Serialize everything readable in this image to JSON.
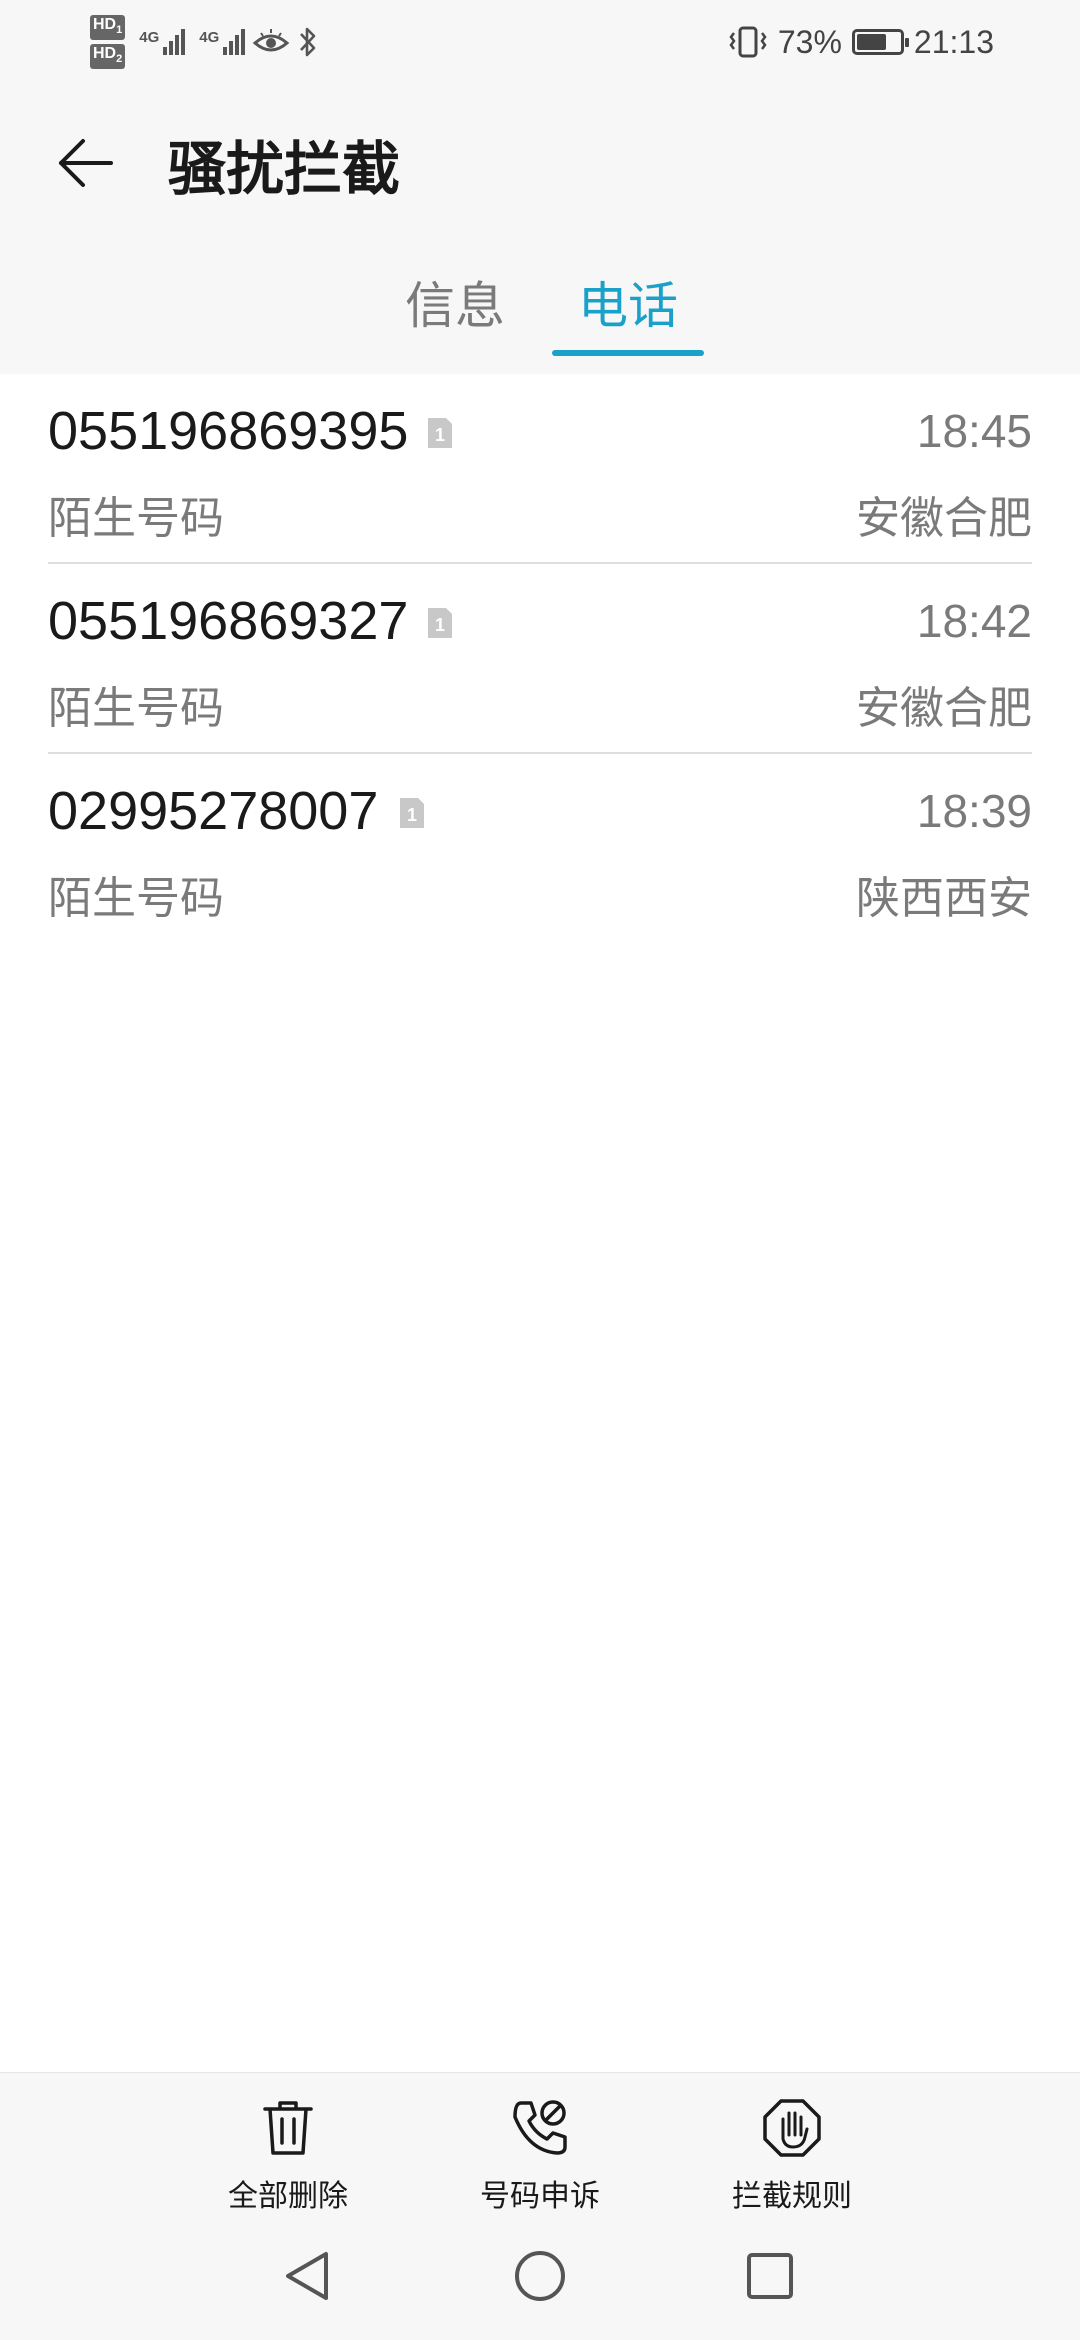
{
  "status_bar": {
    "hd1": "HD",
    "hd1_sim": "1",
    "hd2": "HD",
    "hd2_sim": "2",
    "network1": "4G",
    "network2": "4G",
    "battery_percent": "73%",
    "battery_level": 0.73,
    "time": "21:13",
    "icons": [
      "vibrate-icon",
      "eye-comfort-icon",
      "bluetooth-icon"
    ]
  },
  "header": {
    "title": "骚扰拦截",
    "back_icon": "arrow-left-icon",
    "tabs": [
      {
        "label": "信息",
        "active": false
      },
      {
        "label": "电话",
        "active": true
      }
    ]
  },
  "calls": [
    {
      "number": "055196869395",
      "label": "陌生号码",
      "time": "18:45",
      "location": "安徽合肥",
      "sim": "1"
    },
    {
      "number": "055196869327",
      "label": "陌生号码",
      "time": "18:42",
      "location": "安徽合肥",
      "sim": "1"
    },
    {
      "number": "02995278007",
      "label": "陌生号码",
      "time": "18:39",
      "location": "陕西西安",
      "sim": "1"
    }
  ],
  "toolbar": {
    "delete_all": "全部删除",
    "number_appeal": "号码申诉",
    "block_rules": "拦截规则"
  },
  "colors": {
    "accent": "#1aa1c9",
    "background": "#f7f7f7",
    "secondary_text": "#7a7a7a"
  }
}
